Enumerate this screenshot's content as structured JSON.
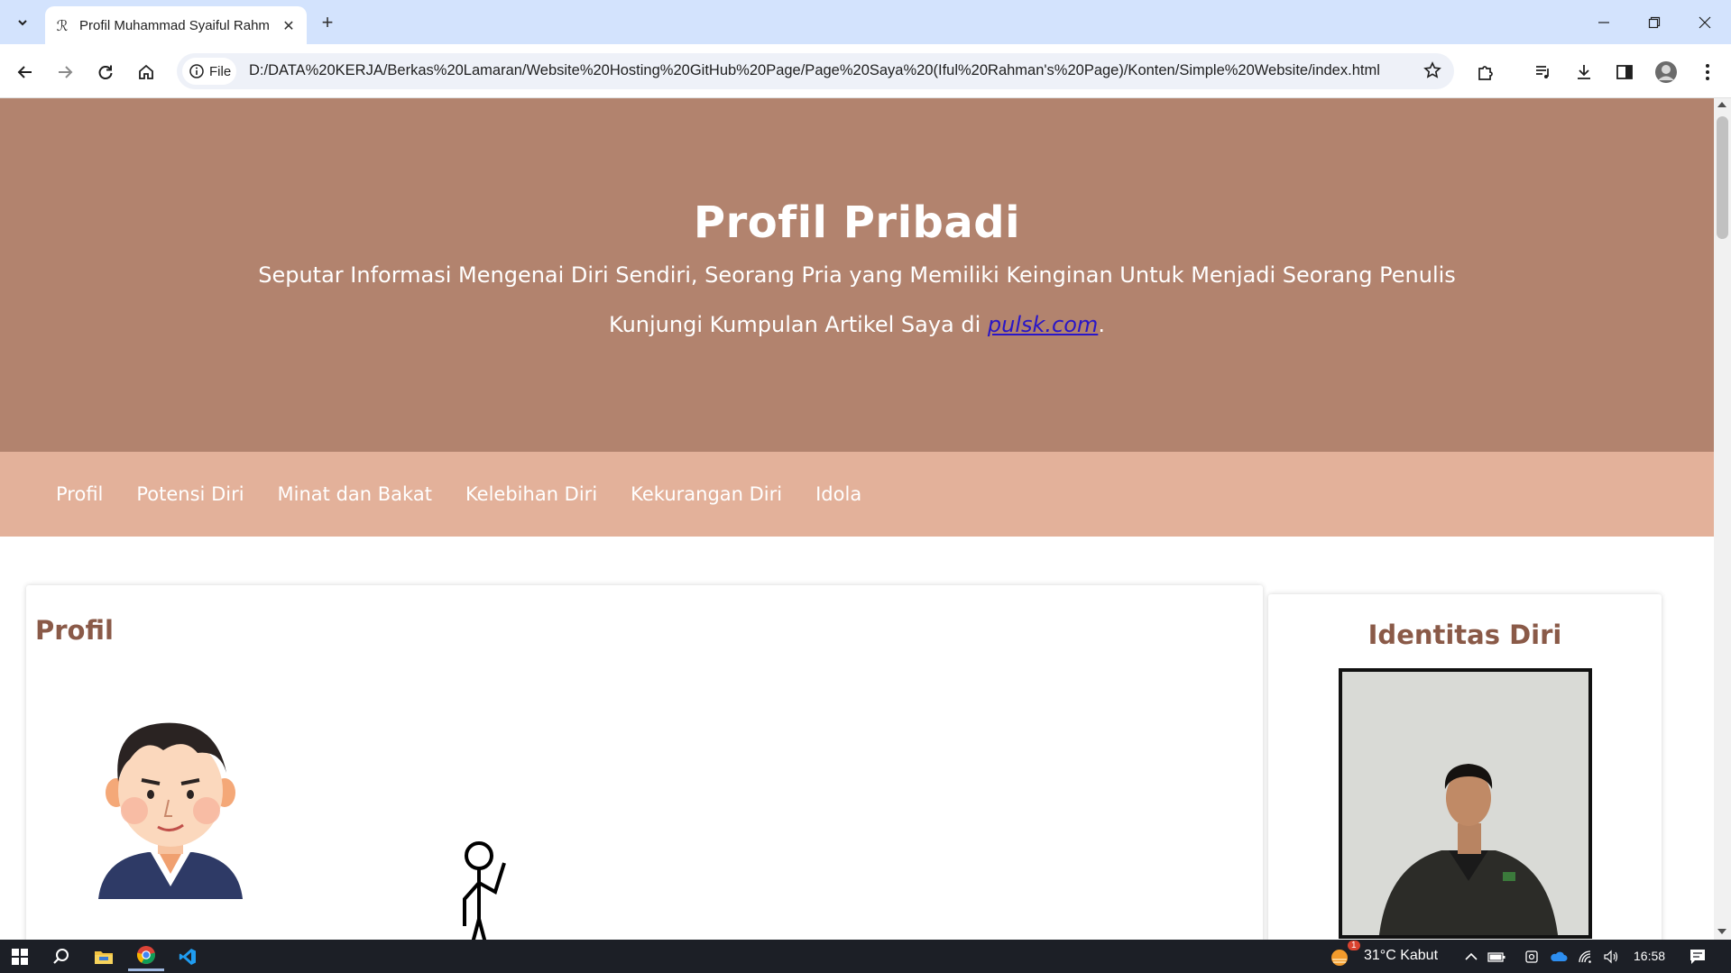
{
  "browser": {
    "tab_title": "Profil Muhammad Syaiful Rahman",
    "url_scheme_label": "File",
    "url": "D:/DATA%20KERJA/Berkas%20Lamaran/Website%20Hosting%20GitHub%20Page/Page%20Saya%20(Iful%20Rahman's%20Page)/Konten/Simple%20Website/index.html"
  },
  "header": {
    "title": "Profil Pribadi",
    "tagline": "Seputar Informasi Mengenai Diri Sendiri, Seorang Pria yang Memiliki Keinginan Untuk Menjadi Seorang Penulis",
    "visit_prefix": "Kunjungi Kumpulan Artikel Saya di ",
    "visit_link": "pulsk.com",
    "visit_suffix": "."
  },
  "nav": {
    "items": [
      {
        "label": "Profil"
      },
      {
        "label": "Potensi Diri"
      },
      {
        "label": "Minat dan Bakat"
      },
      {
        "label": "Kelebihan Diri"
      },
      {
        "label": "Kekurangan Diri"
      },
      {
        "label": "Idola"
      }
    ]
  },
  "main": {
    "section_title": "Profil"
  },
  "sidebar": {
    "title": "Identitas Diri"
  },
  "taskbar": {
    "weather": "31°C  Kabut",
    "weather_badge": "1",
    "time": "16:58"
  },
  "colors": {
    "header_bg": "#b2836e",
    "nav_bg": "#e3b19a",
    "heading": "#8a5a48",
    "link": "#2a16c7"
  }
}
